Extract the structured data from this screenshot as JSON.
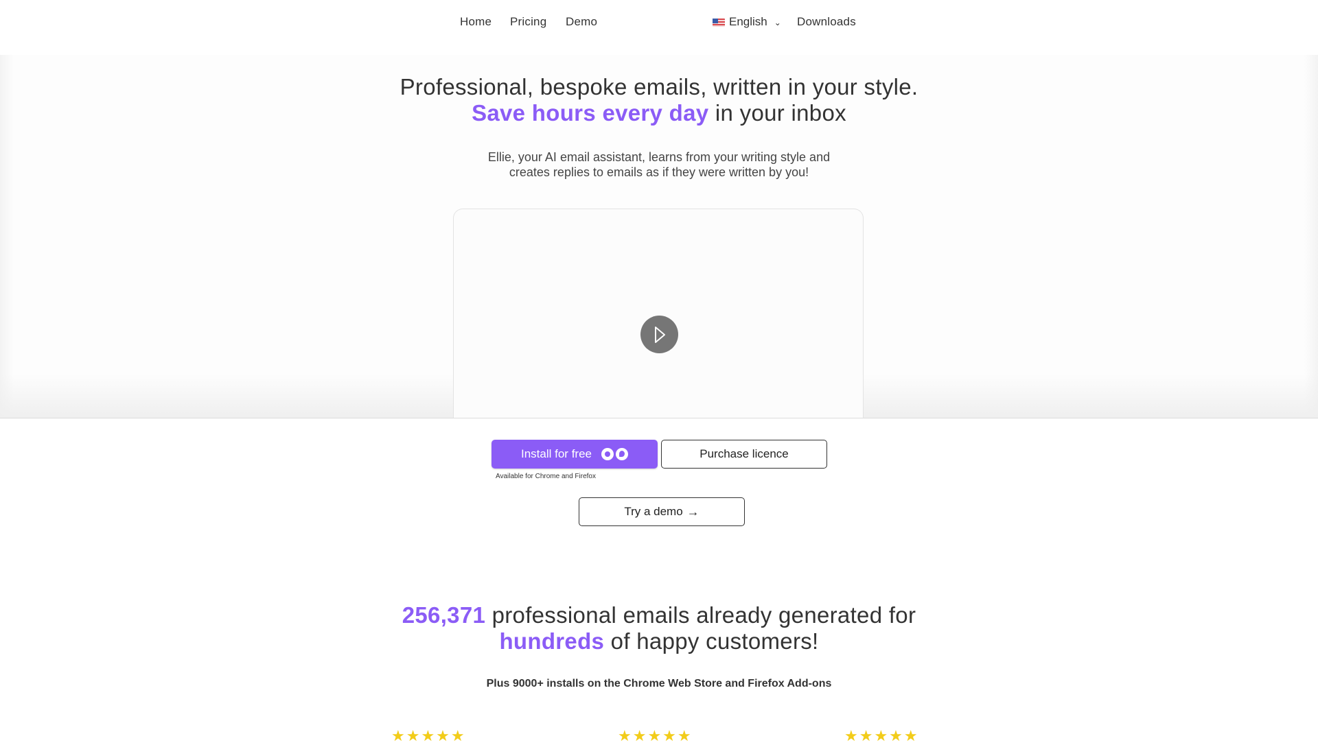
{
  "nav": {
    "links": [
      "Home",
      "Pricing",
      "Demo"
    ],
    "language": {
      "flag": "us-flag",
      "label": "English"
    },
    "downloads": "Downloads"
  },
  "hero": {
    "headline_pre": "Professional, bespoke emails, written in your style.",
    "headline_accent": "Save hours every day",
    "headline_post": "in your inbox",
    "subtitle_line1": "Ellie, your AI email assistant, learns from your writing style and",
    "subtitle_line2": "creates replies to emails as if they were written by you!",
    "video": {
      "play_icon": "play-icon"
    }
  },
  "cta": {
    "install_label": "Install for free",
    "install_icons": [
      "chrome-icon",
      "firefox-icon"
    ],
    "available_note": "Available for Chrome and Firefox",
    "purchase_label": "Purchase licence",
    "demo_label": "Try a demo",
    "demo_arrow": "→"
  },
  "stats": {
    "count": "256,371",
    "line1_rest": "professional emails already generated for",
    "accent_word": "hundreds",
    "line2_rest": "of happy customers!",
    "installs": "Plus 9000+ installs on the Chrome Web Store and Firefox Add-ons"
  },
  "reviews": [
    {
      "stars": "★★★★★",
      "rating": 5
    },
    {
      "stars": "★★★★★",
      "rating": 5
    },
    {
      "stars": "★★★★★",
      "rating": 5
    }
  ],
  "colors": {
    "accent": "#8b5cf6",
    "star": "#f2cc1a"
  }
}
